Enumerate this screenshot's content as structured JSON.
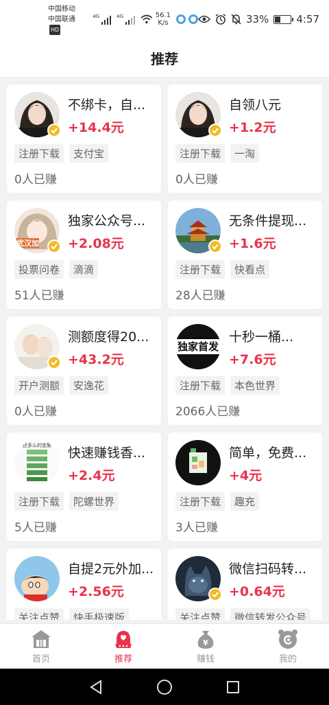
{
  "status_bar": {
    "carrier_1": "中国移动",
    "carrier_2": "中国联通",
    "hd": "HD",
    "net_1": "4G",
    "net_2": "4G",
    "speed_value": "56.1",
    "speed_unit": "K/s",
    "battery": "33%",
    "battery_level": 0.33,
    "time": "4:57"
  },
  "header": {
    "title": "推荐"
  },
  "cards": [
    {
      "title": "不绑卡，自...",
      "reward": "+14.4元",
      "tags": [
        "注册下载",
        "支付宝"
      ],
      "earned": "0人已赚",
      "avatar": "girl-portrait",
      "verified": true
    },
    {
      "title": "自领八元",
      "reward": "+1.2元",
      "tags": [
        "注册下载",
        "一淘"
      ],
      "earned": "0人已赚",
      "avatar": "girl-portrait",
      "verified": true
    },
    {
      "title": "独家公众号...",
      "reward": "+2.08元",
      "tags": [
        "投票问卷",
        "滴滴"
      ],
      "earned": "51人已赚",
      "avatar": "anime-girl",
      "avatar_text": "武汉加",
      "verified": true
    },
    {
      "title": "无条件提现...",
      "reward": "+1.6元",
      "tags": [
        "注册下载",
        "快看点"
      ],
      "earned": "28人已赚",
      "avatar": "pagoda",
      "verified": true
    },
    {
      "title": "测额度得20...",
      "reward": "+43.2元",
      "tags": [
        "开户测额",
        "安逸花"
      ],
      "earned": "0人已赚",
      "avatar": "couple",
      "verified": true
    },
    {
      "title": "十秒一桶...",
      "reward": "+7.6元",
      "tags": [
        "注册下载",
        "本色世界"
      ],
      "earned": "2066人已赚",
      "avatar": "text-logo",
      "avatar_text": "独家首发",
      "verified": false
    },
    {
      "title": "快速赚钱香...",
      "reward": "+2.4元",
      "tags": [
        "注册下载",
        "陀螺世界"
      ],
      "earned": "5人已赚",
      "avatar": "steps-chart",
      "avatar_text": "还多么的宣集",
      "verified": false
    },
    {
      "title": "简单，免费...",
      "reward": "+4元",
      "tags": [
        "注册下载",
        "趣充"
      ],
      "earned": "3人已赚",
      "avatar": "qr-card",
      "verified": false
    },
    {
      "title": "自提2元外加...",
      "reward": "+2.56元",
      "tags": [
        "关注点赞",
        "快手极速版"
      ],
      "earned": "",
      "avatar": "cartoon-boy",
      "verified": false
    },
    {
      "title": "微信扫码转...",
      "reward": "+0.64元",
      "tags": [
        "关注点赞",
        "微信转发公众号"
      ],
      "earned": "",
      "avatar": "wolf",
      "verified": true
    }
  ],
  "tabbar": {
    "tabs": [
      {
        "label": "首页",
        "icon": "home-icon",
        "active": false
      },
      {
        "label": "推荐",
        "icon": "recommend-icon",
        "active": true
      },
      {
        "label": "赚钱",
        "icon": "money-bag-icon",
        "active": false
      },
      {
        "label": "我的",
        "icon": "profile-icon",
        "active": false
      }
    ]
  },
  "colors": {
    "accent": "#e8334a",
    "verified": "#f5b922",
    "tag_bg": "#f2f2f2"
  }
}
